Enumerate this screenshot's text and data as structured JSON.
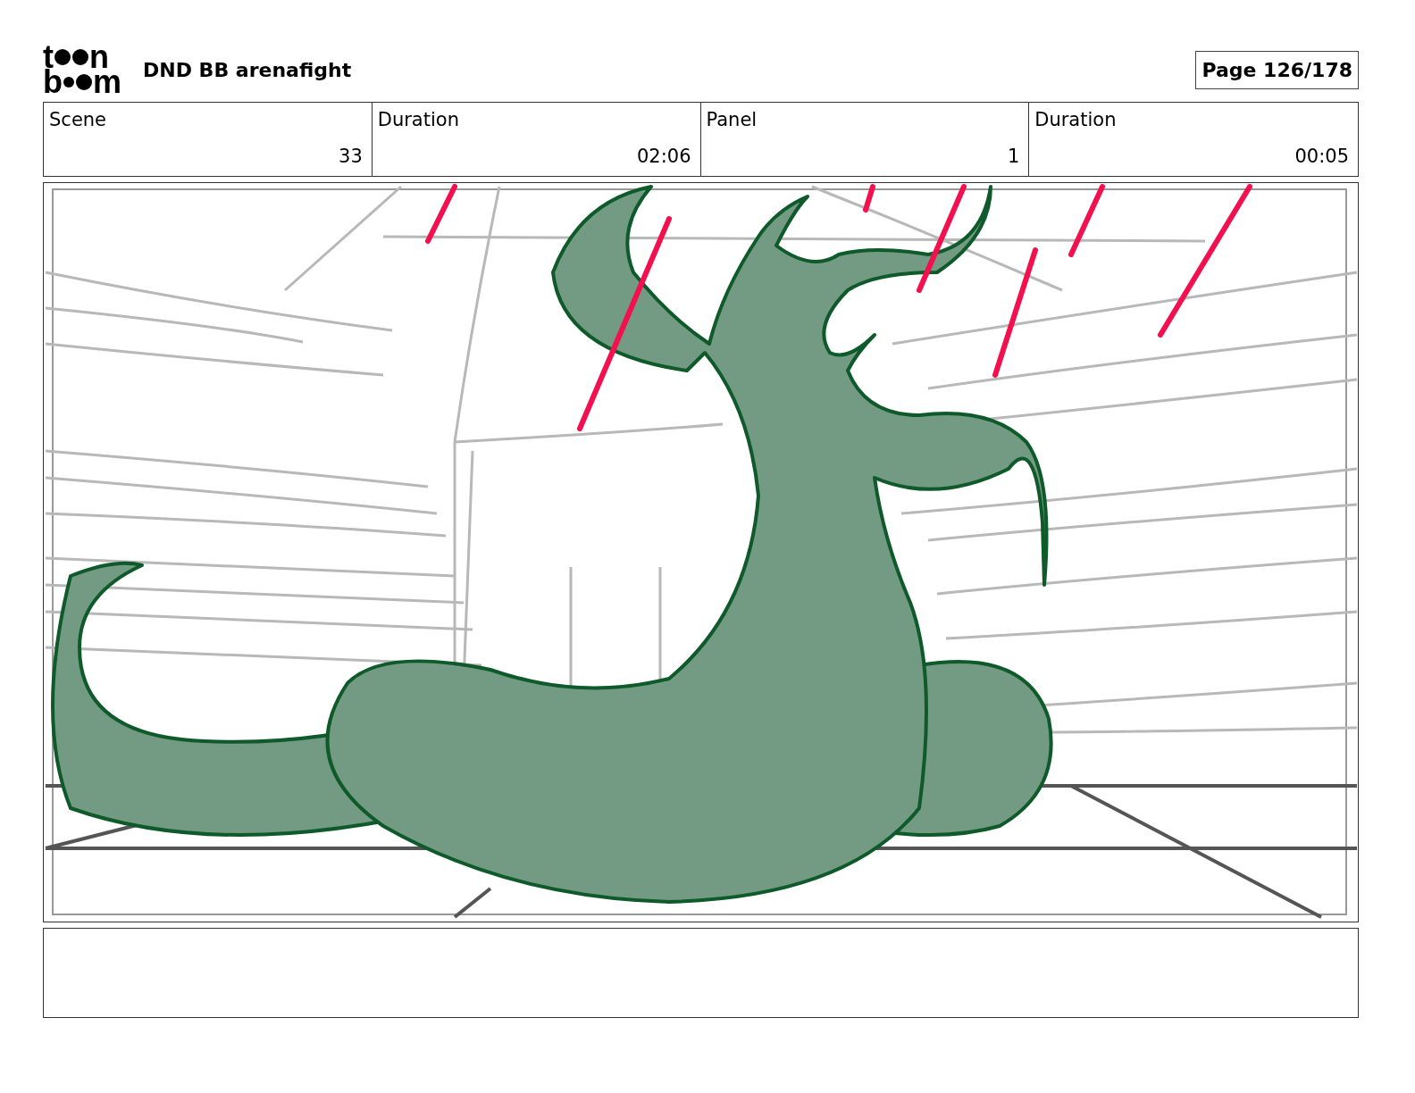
{
  "logo": {
    "top_letters": [
      "t",
      "n"
    ],
    "bottom_letters": [
      "b",
      "m"
    ]
  },
  "project_title": "DND BB arenafight",
  "page_label": "Page 126/178",
  "info_table": {
    "headings": [
      "Scene",
      "Duration",
      "Panel",
      "Duration"
    ],
    "values": [
      "33",
      "02:06",
      "1",
      "00:05"
    ]
  }
}
